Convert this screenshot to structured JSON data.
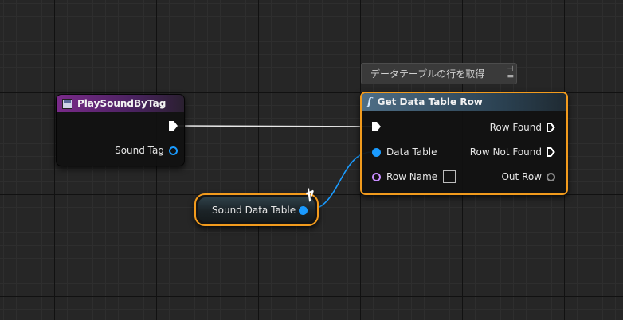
{
  "comment": {
    "text": "データテーブルの行を取得"
  },
  "play_node": {
    "title": "PlaySoundByTag",
    "pins": {
      "sound_tag": "Sound Tag"
    }
  },
  "get_node": {
    "title": "Get Data Table Row",
    "pins": {
      "data_table": "Data Table",
      "row_name": "Row Name",
      "row_found": "Row Found",
      "row_not_found": "Row Not Found",
      "out_row": "Out Row"
    }
  },
  "variable_node": {
    "label": "Sound Data Table"
  },
  "colors": {
    "selection": "#f29b1d",
    "exec_wire": "#e8e8e8",
    "data_table_wire": "#1a9bff",
    "name_pin": "#c98dff",
    "event_header": "#7a2a8a",
    "function_header": "#4e6e86"
  },
  "icons": {
    "event": "event-node-icon",
    "function": "function-f-icon",
    "cursor": "drag-cursor-icon",
    "pin": "pin-icon"
  }
}
